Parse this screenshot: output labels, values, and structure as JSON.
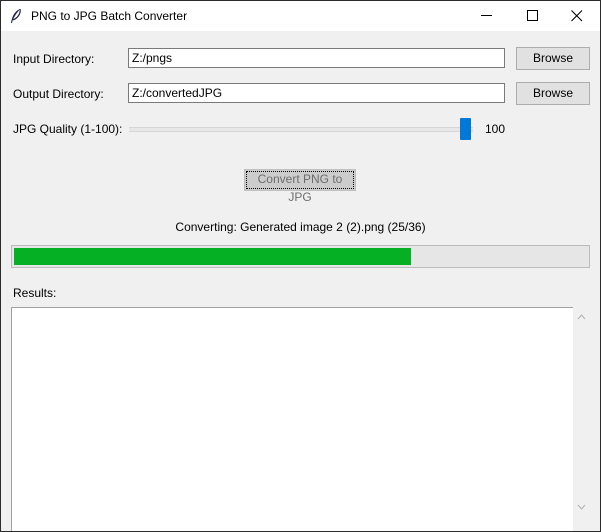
{
  "window": {
    "title": "PNG to JPG Batch Converter",
    "icons": [
      "feather-icon",
      "minimize-icon",
      "maximize-icon",
      "close-icon"
    ]
  },
  "input": {
    "label": "Input Directory:",
    "value": "Z:/pngs",
    "browse_label": "Browse"
  },
  "output": {
    "label": "Output Directory:",
    "value": "Z:/convertedJPG",
    "browse_label": "Browse"
  },
  "quality": {
    "label": "JPG Quality (1-100):",
    "value": "100",
    "min": 1,
    "max": 100
  },
  "convert": {
    "label": "Convert PNG to JPG",
    "enabled": false
  },
  "status": {
    "text": "Converting: Generated image 2 (2).png (25/36)"
  },
  "progress": {
    "done": 25,
    "total": 36,
    "color": "#06b025"
  },
  "results": {
    "label": "Results:",
    "text": ""
  },
  "colors": {
    "accent": "#0078d7",
    "progress": "#06b025"
  }
}
